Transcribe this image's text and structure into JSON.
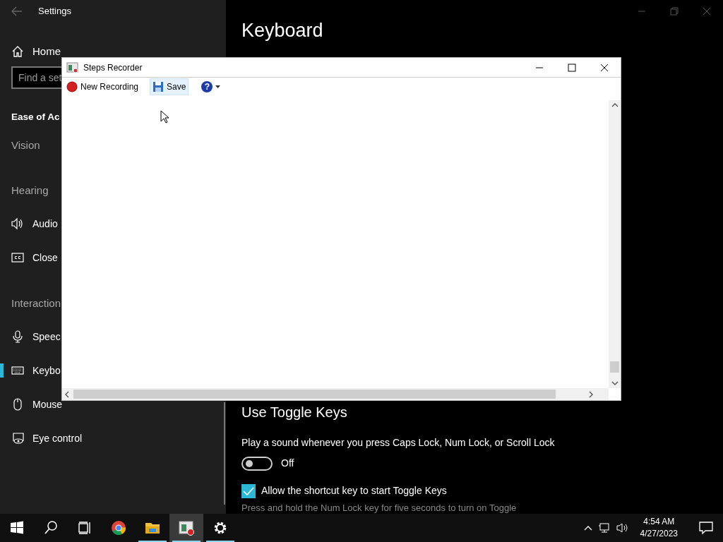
{
  "settings_window": {
    "title": "Settings",
    "sidebar": {
      "home": "Home",
      "search": {
        "placeholder": "Find a set"
      },
      "section_title": "Ease of Ac",
      "items": [
        {
          "kind": "heading",
          "label": "Vision"
        },
        {
          "kind": "heading",
          "label": "Hearing"
        },
        {
          "kind": "item",
          "label": "Audio",
          "selected": false
        },
        {
          "kind": "item",
          "label": "Close",
          "selected": false
        },
        {
          "kind": "heading",
          "label": "Interaction"
        },
        {
          "kind": "item",
          "label": "Speec",
          "selected": false
        },
        {
          "kind": "item",
          "label": "Keybo",
          "selected": true
        },
        {
          "kind": "item",
          "label": "Mouse",
          "selected": false
        },
        {
          "kind": "item",
          "label": "Eye control",
          "selected": false
        }
      ]
    },
    "page_title": "Keyboard",
    "toggle_keys": {
      "heading": "Use Toggle Keys",
      "description": "Play a sound whenever you press Caps Lock, Num Lock, or Scroll Lock",
      "toggle": {
        "on": false,
        "label": "Off"
      },
      "shortcut": {
        "checked": true,
        "label": "Allow the shortcut key to start Toggle Keys"
      },
      "hint": "Press and hold the Num Lock key for five seconds to turn on Toggle"
    }
  },
  "steps_recorder": {
    "title": "Steps Recorder",
    "toolbar": [
      {
        "kind": "record",
        "label": "New Recording",
        "hovered": false
      },
      {
        "kind": "save",
        "label": "Save",
        "hovered": true
      },
      {
        "kind": "help",
        "label": "?",
        "hovered": false
      }
    ]
  },
  "taskbar": {
    "apps": [
      {
        "kind": "browser",
        "running": false,
        "active": false
      },
      {
        "kind": "folder",
        "running": true,
        "active": false
      },
      {
        "kind": "recorder",
        "running": true,
        "active": true
      },
      {
        "kind": "settings",
        "running": true,
        "active": false
      }
    ],
    "time": "4:54 AM",
    "date": "4/27/2023"
  }
}
